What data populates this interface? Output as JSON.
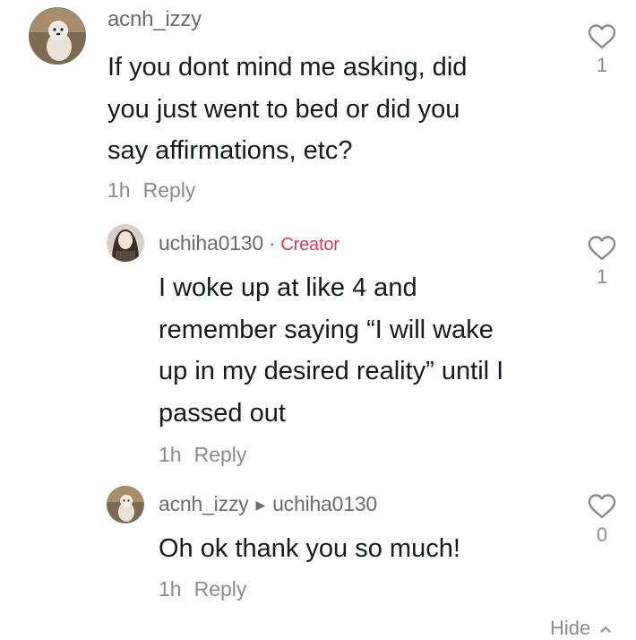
{
  "comment": {
    "username": "acnh_izzy",
    "text_lines": [
      "If you dont mind me asking, did",
      "you just went to bed or did you",
      "say affirmations, etc?"
    ],
    "time": "1h",
    "reply_label": "Reply",
    "likes": "1"
  },
  "reply1": {
    "username": "uchiha0130",
    "separator": "·",
    "badge": "Creator",
    "text_lines": [
      "I woke up at like 4 and",
      "remember saying “I will wake",
      "up in my desired reality” until I",
      "passed out"
    ],
    "time": "1h",
    "reply_label": "Reply",
    "likes": "1"
  },
  "reply2": {
    "username": "acnh_izzy",
    "reply_to": "uchiha0130",
    "text_lines": [
      "Oh ok thank you so much!"
    ],
    "time": "1h",
    "reply_label": "Reply",
    "likes": "0"
  },
  "hide_label": "Hide",
  "colors": {
    "creator": "#e0365a",
    "text": "#161823",
    "muted": "#8a8b91"
  },
  "icons": {
    "like": "heart-outline-icon",
    "collapse": "chevron-up-icon",
    "reply_to": "caret-right-icon"
  }
}
